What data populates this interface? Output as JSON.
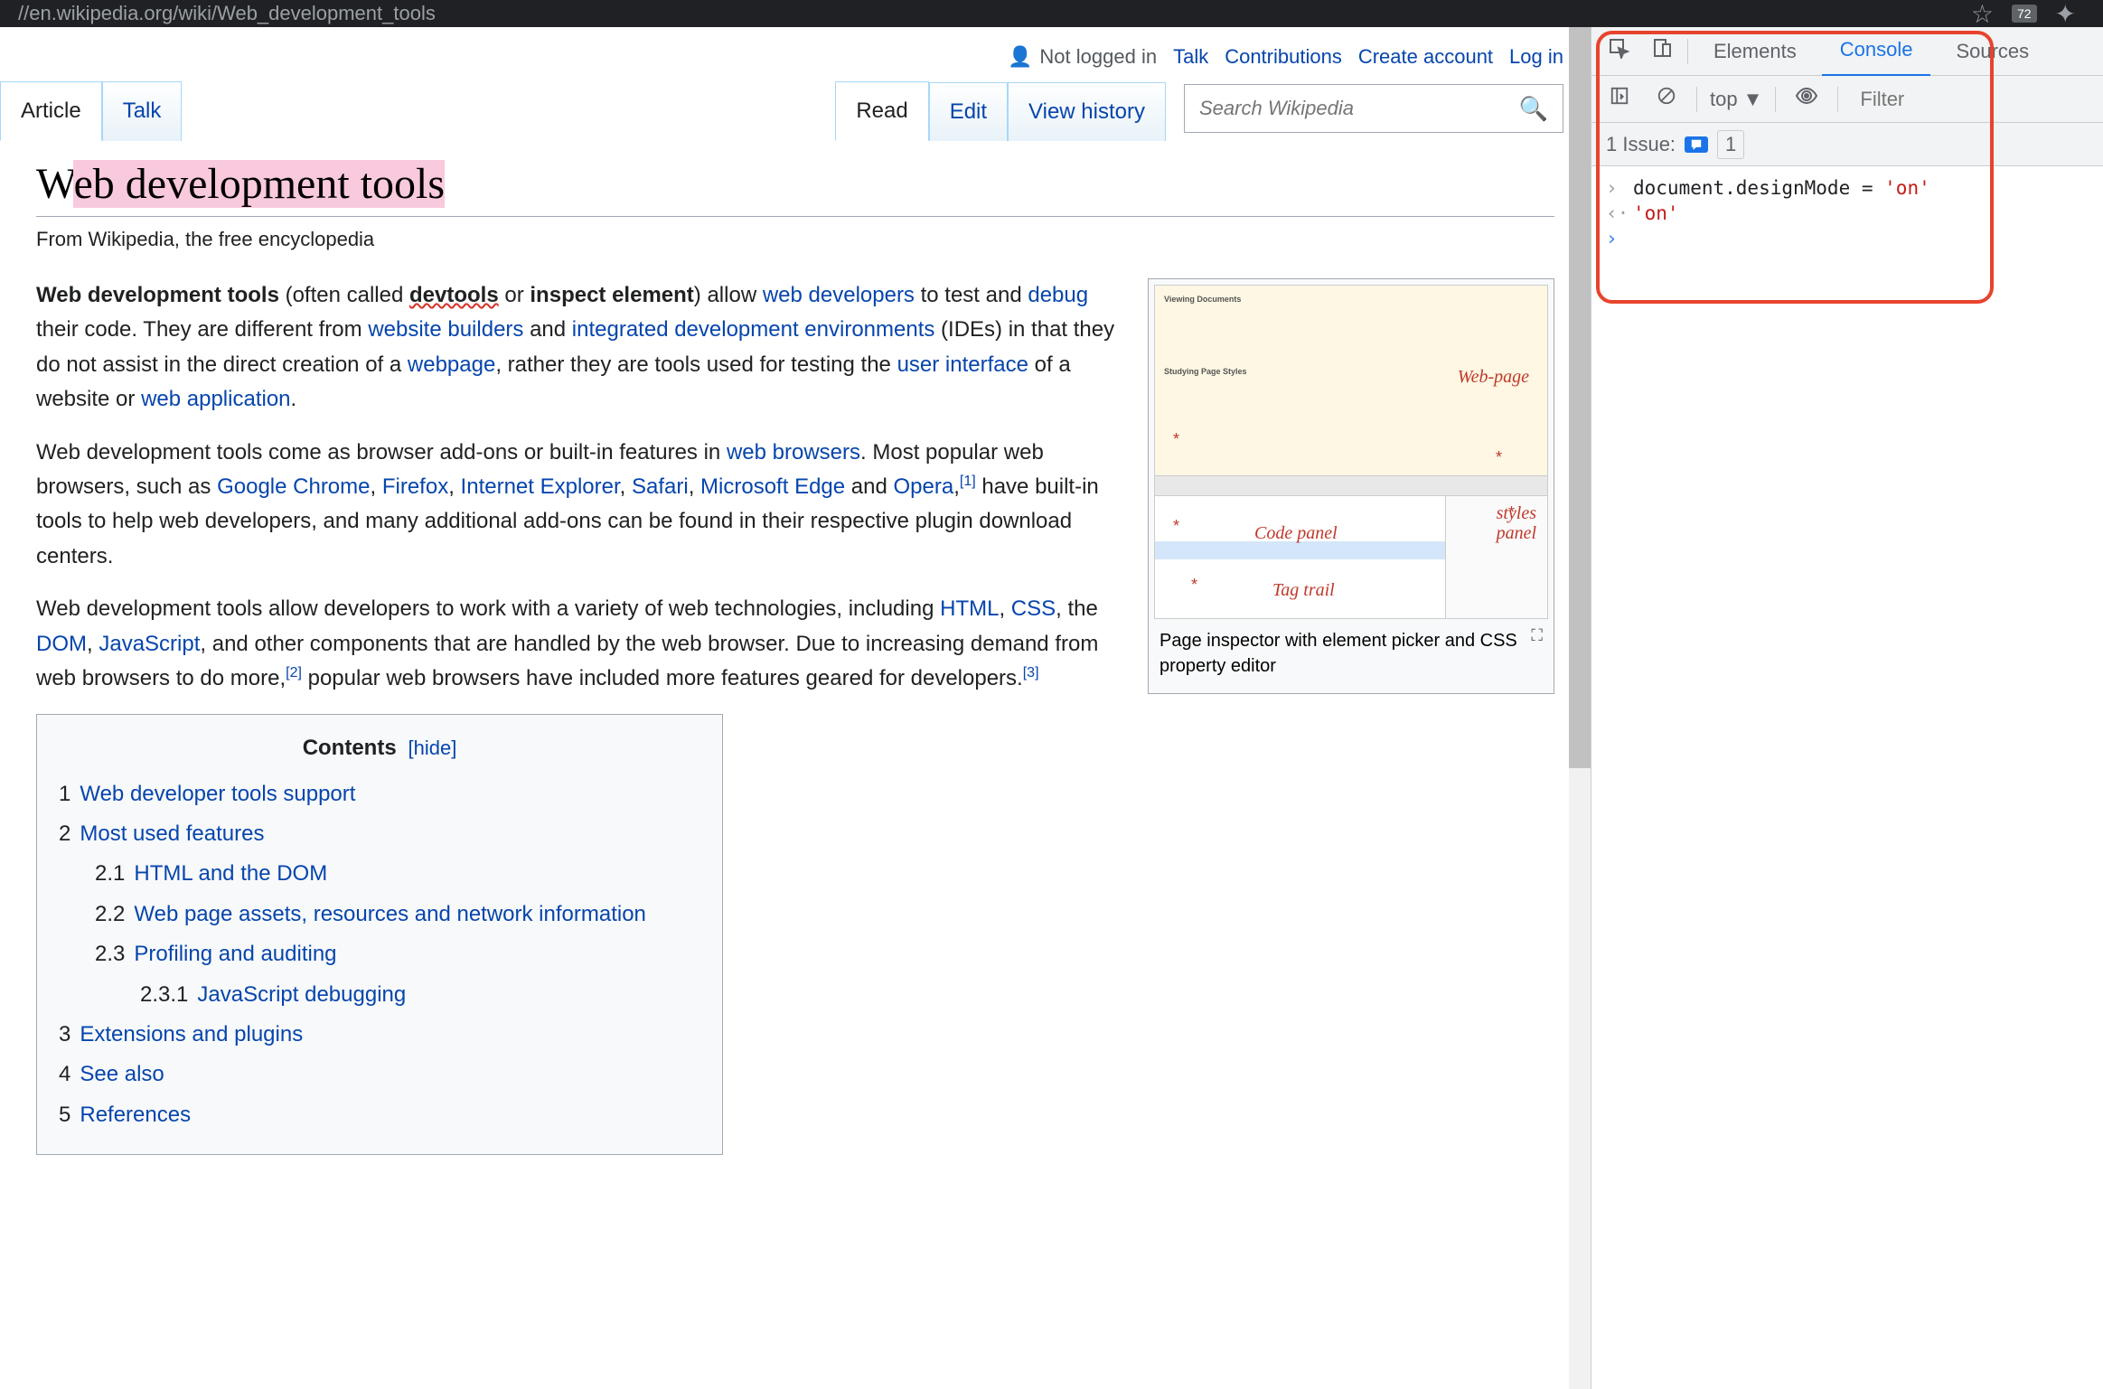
{
  "browser": {
    "url": "//en.wikipedia.org/wiki/Web_development_tools",
    "ext_count": "72"
  },
  "header": {
    "not_logged_in": "Not logged in",
    "talk": "Talk",
    "contributions": "Contributions",
    "create_account": "Create account",
    "log_in": "Log in"
  },
  "tabs": {
    "article": "Article",
    "talk": "Talk",
    "read": "Read",
    "edit": "Edit",
    "view_history": "View history"
  },
  "search": {
    "placeholder": "Search Wikipedia"
  },
  "page": {
    "title_pre": "W",
    "title_hl": "eb development tools",
    "subtitle": "From Wikipedia, the free encyclopedia"
  },
  "para1": {
    "b1": "Web development tools",
    "t1": " (often called ",
    "b2": "devtools",
    "t2": " or ",
    "b3": "inspect element",
    "t3": ") allow ",
    "l1": "web developers",
    "t4": " to test and ",
    "l2": "debug",
    "t5": " their code. They are different from ",
    "l3": "website builders",
    "t6": " and ",
    "l4": "integrated development environments",
    "t7": " (IDEs) in that they do not assist in the direct creation of a ",
    "l5": "webpage",
    "t8": ", rather they are tools used for testing the ",
    "l6": "user interface",
    "t9": " of a website or ",
    "l7": "web application",
    "t10": "."
  },
  "para2": {
    "t1": "Web development tools come as browser add-ons or built-in features in ",
    "l1": "web browsers",
    "t2": ". Most popular web browsers, such as ",
    "l2": "Google Chrome",
    "c1": ", ",
    "l3": "Firefox",
    "c2": ", ",
    "l4": "Internet Explorer",
    "c3": ", ",
    "l5": "Safari",
    "c4": ", ",
    "l6": "Microsoft Edge",
    "t3": " and ",
    "l7": "Opera",
    "c5": ",",
    "ref1": "[1]",
    "t4": " have built-in tools to help web developers, and many additional add-ons can be found in their respective plugin download centers."
  },
  "para3": {
    "t1": "Web development tools allow developers to work with a variety of web technologies, including ",
    "l1": "HTML",
    "c1": ", ",
    "l2": "CSS",
    "t2": ", the ",
    "l3": "DOM",
    "c2": ", ",
    "l4": "JavaScript",
    "t3": ", and other components that are handled by the web browser. Due to increasing demand from web browsers to do more,",
    "ref2": "[2]",
    "t4": " popular web browsers have included more features geared for developers.",
    "ref3": "[3]"
  },
  "infobox": {
    "caption": "Page inspector with element picker and CSS property editor",
    "lbl_webpage": "Web-page",
    "lbl_code": "Code panel",
    "lbl_styles1": "styles",
    "lbl_styles2": "panel",
    "lbl_tag": "Tag trail",
    "mini_h1": "Viewing Documents",
    "mini_h2": "Studying Page Styles"
  },
  "toc": {
    "title": "Contents",
    "hide": "hide",
    "items": [
      {
        "num": "1",
        "label": "Web developer tools support",
        "lvl": 1
      },
      {
        "num": "2",
        "label": "Most used features",
        "lvl": 1
      },
      {
        "num": "2.1",
        "label": "HTML and the DOM",
        "lvl": 2
      },
      {
        "num": "2.2",
        "label": "Web page assets, resources and network information",
        "lvl": 2
      },
      {
        "num": "2.3",
        "label": "Profiling and auditing",
        "lvl": 2
      },
      {
        "num": "2.3.1",
        "label": "JavaScript debugging",
        "lvl": 3
      },
      {
        "num": "3",
        "label": "Extensions and plugins",
        "lvl": 1
      },
      {
        "num": "4",
        "label": "See also",
        "lvl": 1
      },
      {
        "num": "5",
        "label": "References",
        "lvl": 1
      }
    ]
  },
  "devtools": {
    "tabs": {
      "elements": "Elements",
      "console": "Console",
      "sources": "Sources"
    },
    "toolbar": {
      "context": "top",
      "filter_placeholder": "Filter"
    },
    "issues": {
      "label": "1 Issue:",
      "count": "1"
    },
    "console": {
      "input_code_pre": "document.designMode = ",
      "input_code_str": "'on'",
      "output": "'on'"
    }
  }
}
